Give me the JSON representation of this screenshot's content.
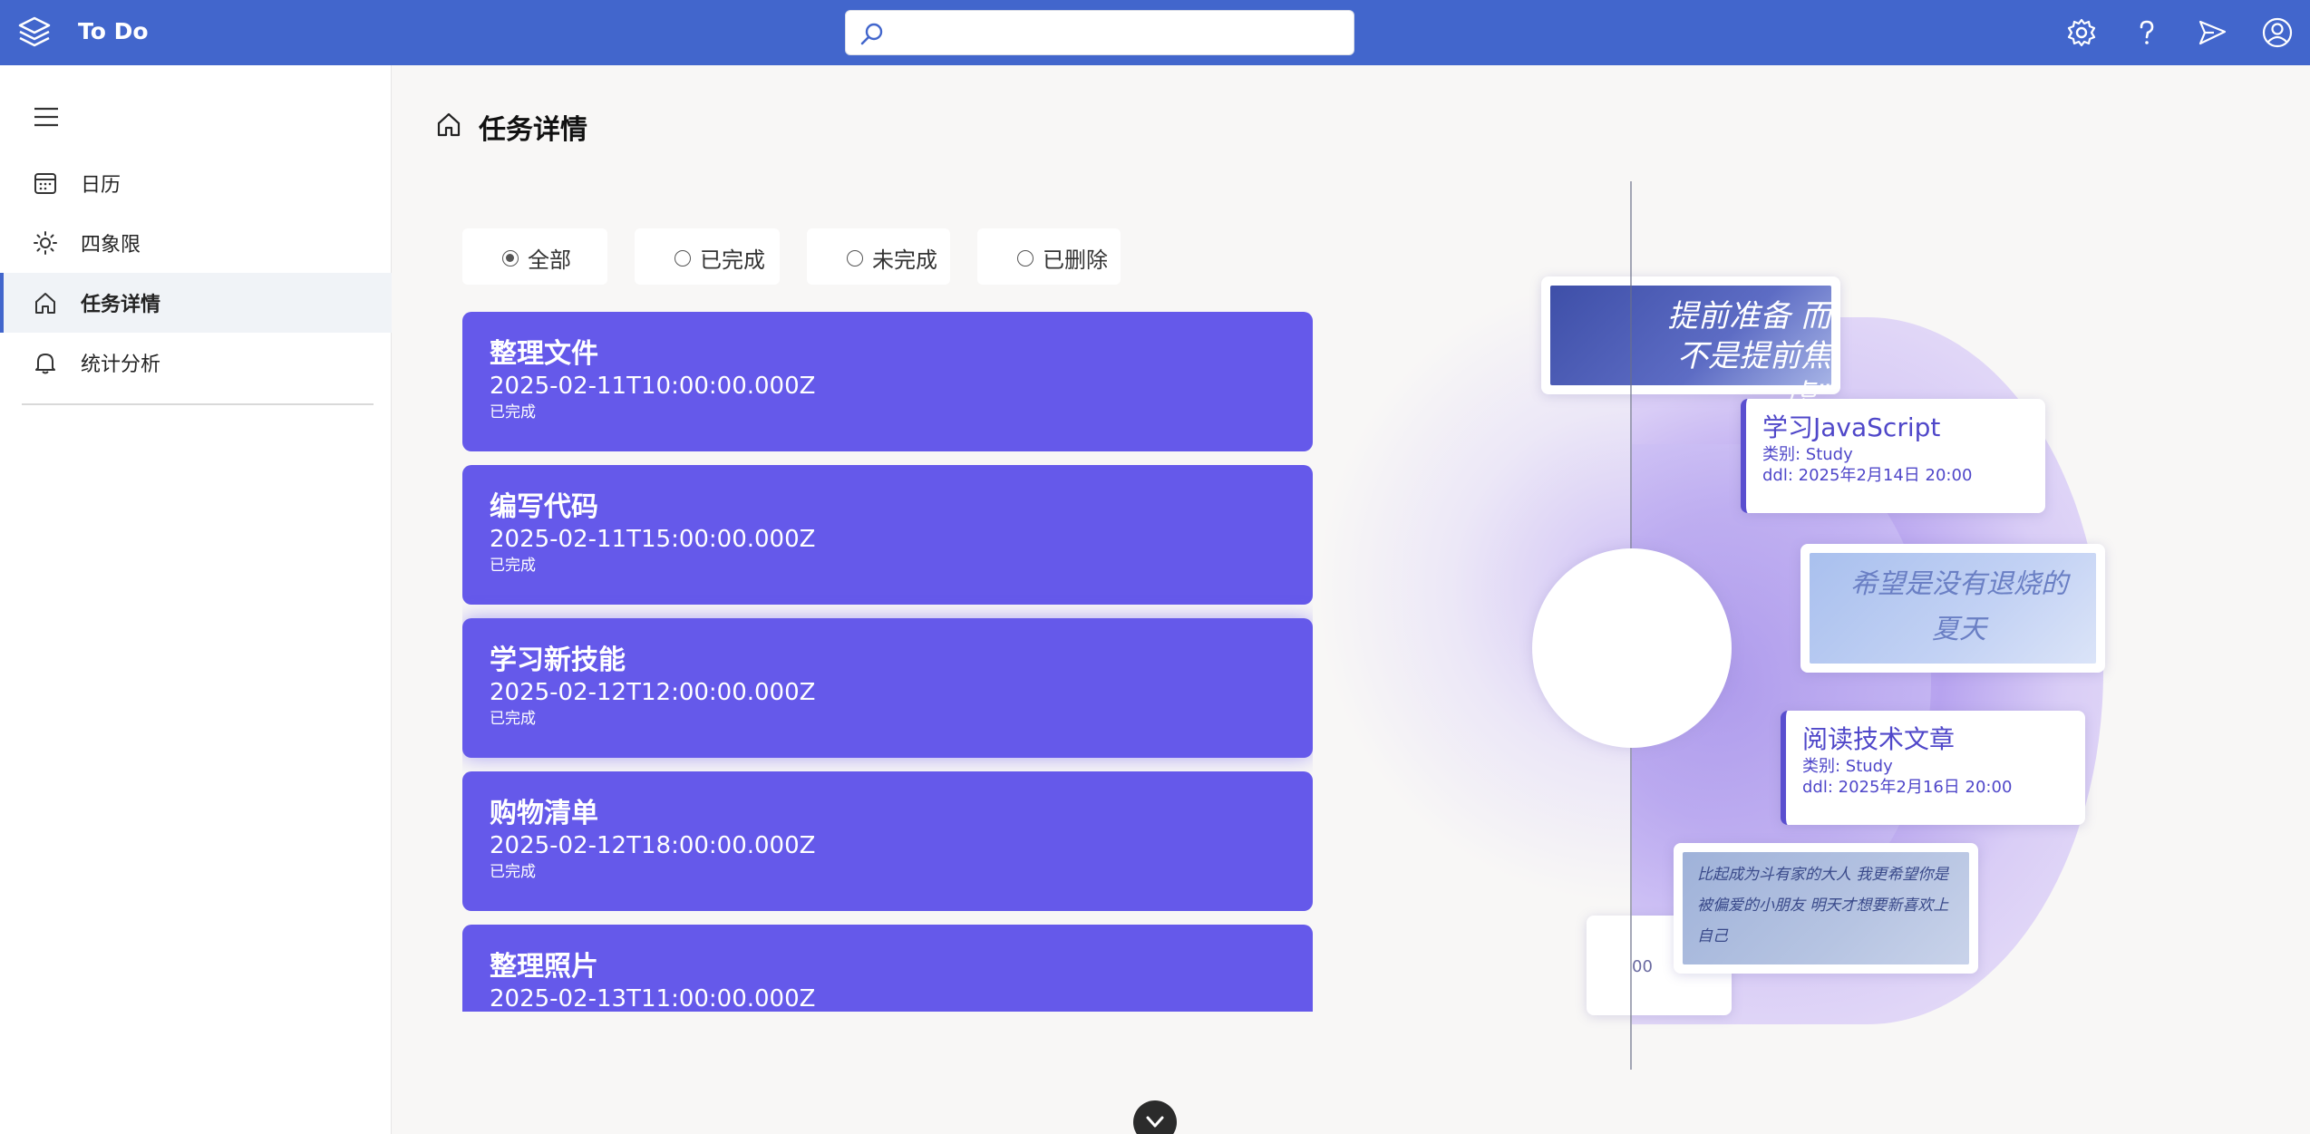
{
  "app": {
    "title": "To Do"
  },
  "search": {
    "placeholder": "",
    "value": ""
  },
  "topbar_icons": [
    "gear-icon",
    "question-icon",
    "send-icon",
    "user-icon"
  ],
  "sidebar": {
    "items": [
      {
        "label": "日历",
        "icon": "calendar-icon",
        "active": false
      },
      {
        "label": "四象限",
        "icon": "sun-icon",
        "active": false
      },
      {
        "label": "任务详情",
        "icon": "home-icon",
        "active": true
      },
      {
        "label": "统计分析",
        "icon": "bell-icon",
        "active": false
      }
    ]
  },
  "page": {
    "title": "任务详情"
  },
  "filters": [
    {
      "label": "全部",
      "checked": true
    },
    {
      "label": "已完成",
      "checked": false
    },
    {
      "label": "未完成",
      "checked": false
    },
    {
      "label": "已删除",
      "checked": false
    }
  ],
  "tasks": [
    {
      "title": "整理文件",
      "time": "2025-02-11T10:00:00.000Z",
      "status": "已完成"
    },
    {
      "title": "编写代码",
      "time": "2025-02-11T15:00:00.000Z",
      "status": "已完成"
    },
    {
      "title": "学习新技能",
      "time": "2025-02-12T12:00:00.000Z",
      "status": "已完成"
    },
    {
      "title": "购物清单",
      "time": "2025-02-12T18:00:00.000Z",
      "status": "已完成"
    },
    {
      "title": "整理照片",
      "time": "2025-02-13T11:00:00.000Z",
      "status": ""
    }
  ],
  "deco": {
    "photo1_text": "提前准备 而不是提前焦虑”",
    "info1": {
      "title": "学习JavaScript",
      "category": "类别: Study",
      "ddl": "ddl: 2025年2月14日 20:00"
    },
    "photo2_text": "希望是没有退烧的 夏天",
    "info2": {
      "title": "阅读技术文章",
      "category": "类别: Study",
      "ddl": "ddl: 2025年2月16日 20:00"
    },
    "photo3_text": "比起成为斗有家的大人 我更希望你是被偏爱的小朋友 明天才想要新喜欢上自己",
    "partial_text": "00"
  },
  "colors": {
    "topbar": "#4266cc",
    "task_card": "#6559ea",
    "accent": "#4266cc"
  }
}
